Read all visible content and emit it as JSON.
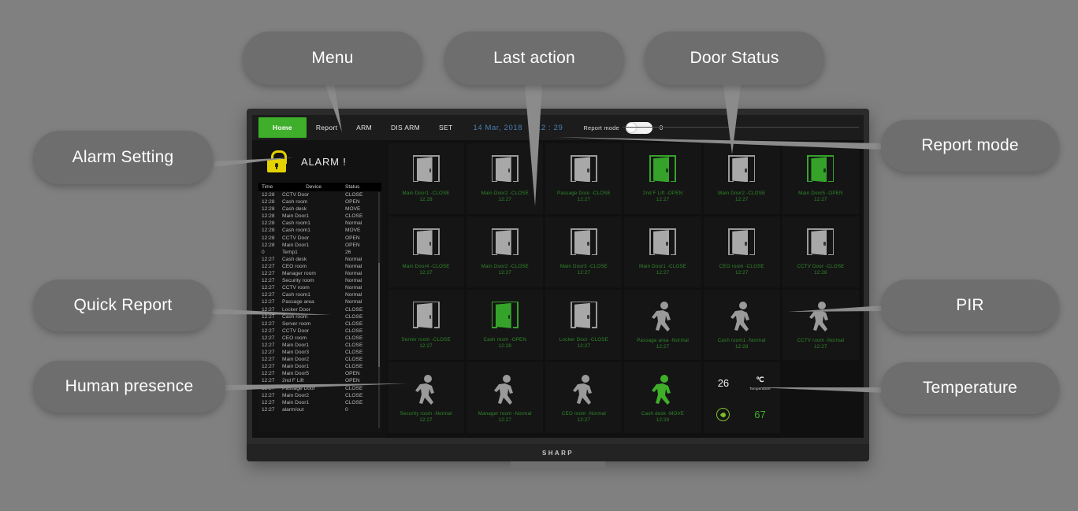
{
  "callouts": [
    {
      "id": "menu",
      "label": "Menu"
    },
    {
      "id": "last-action",
      "label": "Last action"
    },
    {
      "id": "door-status",
      "label": "Door Status"
    },
    {
      "id": "alarm-setting",
      "label": "Alarm Setting"
    },
    {
      "id": "report-mode",
      "label": "Report mode"
    },
    {
      "id": "quick-report",
      "label": "Quick Report"
    },
    {
      "id": "pir",
      "label": "PIR"
    },
    {
      "id": "human-presence",
      "label": "Human presence"
    },
    {
      "id": "temperature",
      "label": "Temperature"
    }
  ],
  "device": {
    "brand": "SHARP"
  },
  "topbar": {
    "nav": [
      "Home",
      "Report",
      "ARM",
      "DIS ARM",
      "SET"
    ],
    "active_nav": "Home",
    "date": "14 Mar, 2018",
    "time": "12 : 29",
    "report_mode_label": "Report mode",
    "report_mode_state": "on",
    "report_mode_value": "0"
  },
  "alarm": {
    "label": "ALARM !",
    "icon": "padlock-icon",
    "color": "#e4d200"
  },
  "log": {
    "columns": [
      "Time",
      "Device",
      "Status"
    ],
    "rows": [
      [
        "12:28",
        "CCTV Door",
        "CLOSE"
      ],
      [
        "12:28",
        "Cash room",
        "OPEN"
      ],
      [
        "12:28",
        "Cash desk",
        "MOVE"
      ],
      [
        "12:28",
        "Main Door1",
        "CLOSE"
      ],
      [
        "12:28",
        "Cash room1",
        "Normal"
      ],
      [
        "12:28",
        "Cash room1",
        "MOVE"
      ],
      [
        "12:28",
        "CCTV Door",
        "OPEN"
      ],
      [
        "12:28",
        "Main Door1",
        "OPEN"
      ],
      [
        "0",
        "Temp1",
        "26"
      ],
      [
        "12:27",
        "Cash desk",
        "Normal"
      ],
      [
        "12:27",
        "CEO room",
        "Normal"
      ],
      [
        "12:27",
        "Manager room",
        "Normal"
      ],
      [
        "12:27",
        "Security room",
        "Normal"
      ],
      [
        "12:27",
        "CCTV room",
        "Normal"
      ],
      [
        "12:27",
        "Cash room1",
        "Normal"
      ],
      [
        "12:27",
        "Passage area",
        "Normal"
      ],
      [
        "12:27",
        "Locker Door",
        "CLOSE"
      ],
      [
        "12:27",
        "Cash room",
        "CLOSE"
      ],
      [
        "12:27",
        "Server room",
        "CLOSE"
      ],
      [
        "12:27",
        "CCTV Door",
        "CLOSE"
      ],
      [
        "12:27",
        "CEO room",
        "CLOSE"
      ],
      [
        "12:27",
        "Main Door1",
        "CLOSE"
      ],
      [
        "12:27",
        "Main Door3",
        "CLOSE"
      ],
      [
        "12:27",
        "Main Door2",
        "CLOSE"
      ],
      [
        "12:27",
        "Main Door1",
        "CLOSE"
      ],
      [
        "12:27",
        "Main Door5",
        "OPEN"
      ],
      [
        "12:27",
        "2nd F Lift",
        "OPEN"
      ],
      [
        "12:27",
        "Passage Door",
        "CLOSE"
      ],
      [
        "12:27",
        "Main Door2",
        "CLOSE"
      ],
      [
        "12:27",
        "Main Door1",
        "CLOSE"
      ],
      [
        "12:27",
        "alarm/out",
        "0"
      ]
    ]
  },
  "grid": {
    "cells": [
      {
        "type": "door",
        "state": "CLOSE",
        "name": "Main Door1",
        "status": "CLOSE",
        "time": "12:28"
      },
      {
        "type": "door",
        "state": "CLOSE",
        "name": "Main Door2",
        "status": "CLOSE",
        "time": "12:27"
      },
      {
        "type": "door",
        "state": "CLOSE",
        "name": "Passage Door",
        "status": "CLOSE",
        "time": "12:27"
      },
      {
        "type": "door",
        "state": "OPEN",
        "name": "2nd F Lift",
        "status": "OPEN",
        "time": "12:27"
      },
      {
        "type": "door",
        "state": "CLOSE",
        "name": "Main Door2",
        "status": "CLOSE",
        "time": "12:27"
      },
      {
        "type": "door",
        "state": "OPEN",
        "name": "Main Door5",
        "status": "OPEN",
        "time": "12:27"
      },
      {
        "type": "door",
        "state": "CLOSE",
        "name": "Main Door4",
        "status": "CLOSE",
        "time": "12:27"
      },
      {
        "type": "door",
        "state": "CLOSE",
        "name": "Main Door2",
        "status": "CLOSE",
        "time": "12:27"
      },
      {
        "type": "door",
        "state": "CLOSE",
        "name": "Main Door3",
        "status": "CLOSE",
        "time": "12:27"
      },
      {
        "type": "door",
        "state": "CLOSE",
        "name": "Main Door1",
        "status": "CLOSE",
        "time": "12:27"
      },
      {
        "type": "door",
        "state": "CLOSE",
        "name": "CEO room",
        "status": "CLOSE",
        "time": "12:27"
      },
      {
        "type": "door",
        "state": "CLOSE",
        "name": "CCTV Door",
        "status": "CLOSE",
        "time": "12:28"
      },
      {
        "type": "door",
        "state": "CLOSE",
        "name": "Server room",
        "status": "CLOSE",
        "time": "12:27"
      },
      {
        "type": "door",
        "state": "OPEN",
        "name": "Cash room",
        "status": "OPEN",
        "time": "12:28"
      },
      {
        "type": "door",
        "state": "CLOSE",
        "name": "Locker Door",
        "status": "CLOSE",
        "time": "12:27"
      },
      {
        "type": "pir",
        "state": "Normal",
        "name": "Passage area",
        "status": "Normal",
        "time": "12:27"
      },
      {
        "type": "pir",
        "state": "Normal",
        "name": "Cash room1",
        "status": "Normal",
        "time": "12:28"
      },
      {
        "type": "pir",
        "state": "Normal",
        "name": "CCTV room",
        "status": "Normal",
        "time": "12:27"
      },
      {
        "type": "pir",
        "state": "Normal",
        "name": "Security room",
        "status": "Normal",
        "time": "12:27"
      },
      {
        "type": "pir",
        "state": "Normal",
        "name": "Manager room",
        "status": "Normal",
        "time": "12:27"
      },
      {
        "type": "pir",
        "state": "Normal",
        "name": "CEO room",
        "status": "Normal",
        "time": "12:27"
      },
      {
        "type": "pir",
        "state": "MOVE",
        "name": "Cash desk",
        "status": "MOVE",
        "time": "12:28"
      },
      {
        "type": "temp",
        "temperature": "26",
        "unit": "℃",
        "unit_label": "Temperature",
        "humidity": "67"
      },
      {
        "type": "empty"
      }
    ]
  }
}
